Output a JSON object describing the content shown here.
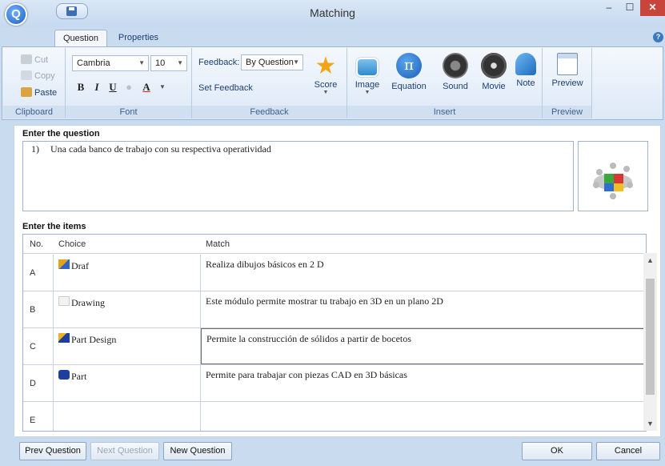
{
  "window": {
    "title": "Matching"
  },
  "app": {
    "logo_letter": "Q"
  },
  "ribbon": {
    "tabs": [
      "Question",
      "Properties"
    ],
    "clipboard": {
      "cut": "Cut",
      "copy": "Copy",
      "paste": "Paste",
      "label": "Clipboard"
    },
    "font": {
      "family": "Cambria",
      "size": "10",
      "bold": "B",
      "italic": "I",
      "underline": "U",
      "color": "A",
      "label": "Font"
    },
    "feedback": {
      "prefix": "Feedback:",
      "value": "By Question",
      "set": "Set Feedback",
      "score": "Score",
      "label": "Feedback"
    },
    "insert": {
      "image": "Image",
      "equation": "Equation",
      "sound": "Sound",
      "movie": "Movie",
      "note": "Note",
      "label": "Insert"
    },
    "preview": {
      "button": "Preview",
      "label": "Preview"
    }
  },
  "question": {
    "section_label": "Enter the question",
    "number": "1)",
    "text": "Una cada banco de trabajo con su respectiva operatividad"
  },
  "items": {
    "section_label": "Enter the items",
    "columns": [
      "No.",
      "Choice",
      "Match"
    ],
    "rows": [
      {
        "no": "A",
        "choice": "Draf",
        "match": "Realiza dibujos básicos en  2 D"
      },
      {
        "no": "B",
        "choice": "Drawing",
        "match": "Este módulo permite mostrar tu trabajo en 3D en un plano 2D"
      },
      {
        "no": "C",
        "choice": "Part Design",
        "match": " Permite la construcción de sólidos a partir de bocetos"
      },
      {
        "no": "D",
        "choice": "Part",
        "match": "Permite para trabajar con piezas CAD en 3D básicas"
      },
      {
        "no": "E",
        "choice": "",
        "match": ""
      }
    ]
  },
  "footer": {
    "prev": "Prev Question",
    "next": "Next Question",
    "new": "New Question",
    "ok": "OK",
    "cancel": "Cancel"
  },
  "colors": {
    "accent": "#1d5fc0",
    "close": "#c7453b",
    "ribbon_label": "#3c5e8f"
  }
}
